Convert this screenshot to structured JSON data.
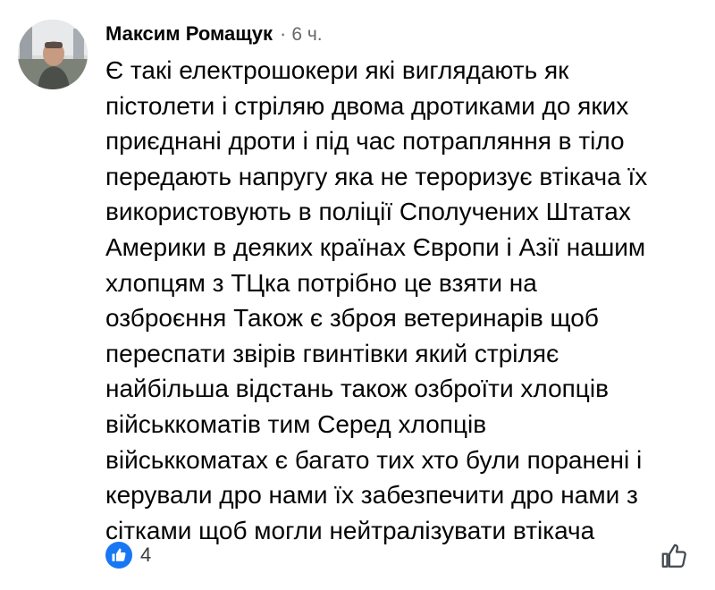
{
  "comment": {
    "author": "Максим Ромащук",
    "separator": "·",
    "time": "6 ч.",
    "text": "Є такі електрошокери які виглядають як\nпістолети і стріляю двома дротиками до яких\nприєднані дроти і під час потрапляння в тіло\nпередають напругу яка не тероризує втікача їх\nвикористовують в поліції Сполучених Штатах\nАмерики в деяких країнах Європи і Азії нашим\nхлопцям з ТЦка потрібно це взяти на\nозброєння  Також є зброя ветеринарів щоб\nпереспати звірів гвинтівки який стріляє\nнайбільша відстань також озброїти хлопців\nвійськкоматів тим    Серед хлопців\nвійськкоматах є багато тих хто були поранені і\nкерували дро нами їх забезпечити дро нами з\nсітками щоб могли нейтралізувати втікача"
  },
  "reactions": {
    "icon": "thumbs-up-icon",
    "count": "4",
    "color": "#1877f2"
  },
  "actions": {
    "like_icon": "thumbs-up-outline-icon"
  }
}
